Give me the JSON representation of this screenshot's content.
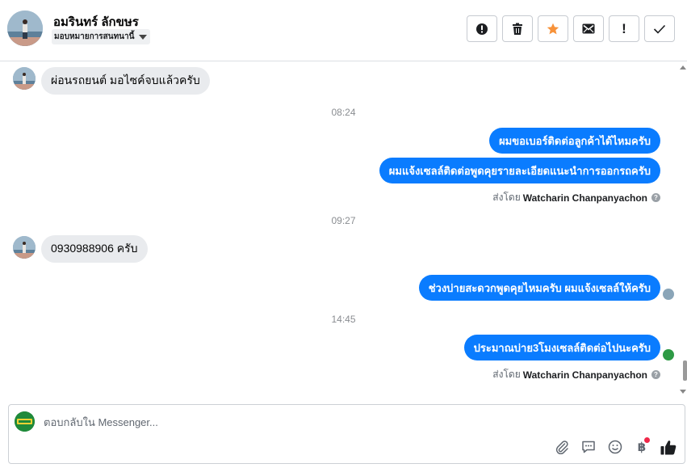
{
  "header": {
    "contact_name": "อมรินทร์ ลักขษร",
    "assign_label": "มอบหมายการสนทนานี้",
    "actions": [
      {
        "name": "report-icon"
      },
      {
        "name": "trash-icon"
      },
      {
        "name": "star-icon"
      },
      {
        "name": "envelope-icon"
      },
      {
        "name": "exclamation-icon",
        "glyph": "!"
      },
      {
        "name": "checkmark-icon"
      }
    ]
  },
  "messages": {
    "m1_text": "ผ่อนรถยนต์ มอไซค์จบแล้วครับ",
    "time1": "08:24",
    "m2_text": "ผมขอเบอร์ติดต่อลูกค้าได้ไหมครับ",
    "m3_text": "ผมแจ้งเซลล์ติดต่อพูดคุยรายละเอียดแนะนำการออกรถครับ",
    "sent_by_label_1": "ส่งโดย",
    "sent_by_name_1": "Watcharin Chanpanyachon",
    "time2": "09:27",
    "m4_text": "0930988906 ครับ",
    "m5_text": "ช่วงบ่ายสะดวกพูดคุยไหมครับ ผมแจ้งเซลล์ให้ครับ",
    "time3": "14:45",
    "m6_text": "ประมาณบ่าย3โมงเซลล์ติดต่อไปนะครับ",
    "sent_by_label_2": "ส่งโดย",
    "sent_by_name_2": "Watcharin Chanpanyachon"
  },
  "composer": {
    "placeholder": "ตอบกลับใน Messenger...",
    "value": "",
    "tools": [
      {
        "name": "attachment-icon"
      },
      {
        "name": "saved-replies-icon"
      },
      {
        "name": "emoji-icon"
      },
      {
        "name": "baht-payment-icon",
        "glyph": "฿"
      },
      {
        "name": "like-icon"
      }
    ]
  },
  "colors": {
    "bubble_out": "#0a7cff",
    "bubble_in": "#e9ebee",
    "star": "#f7923a",
    "notification_dot": "#f02849"
  }
}
